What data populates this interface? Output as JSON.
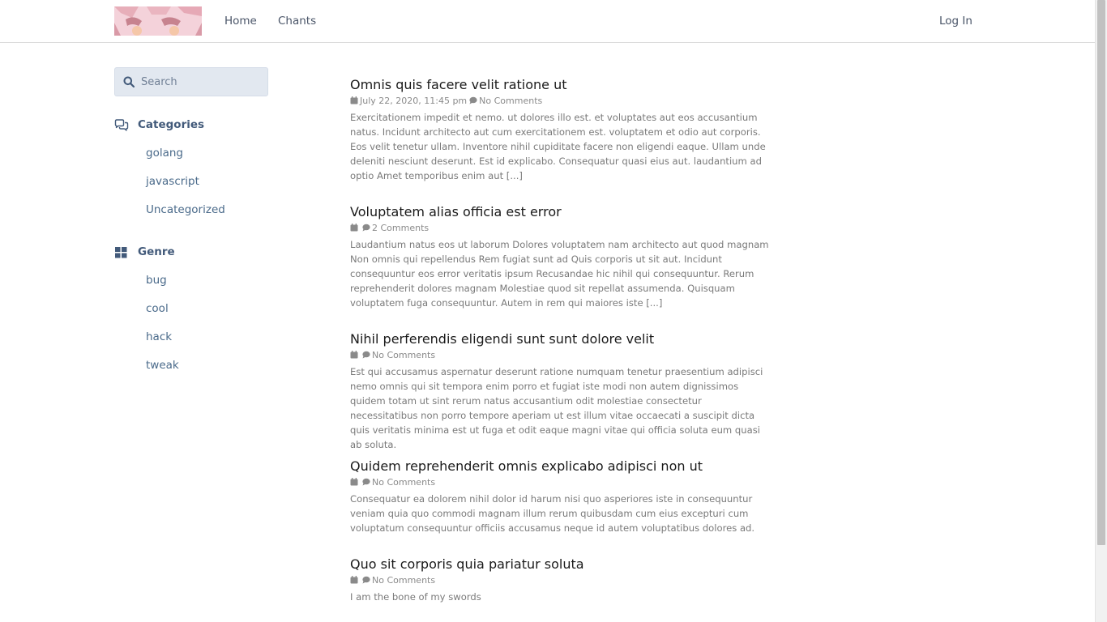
{
  "nav": {
    "logo_alt": "site logo",
    "links": [
      {
        "label": "Home"
      },
      {
        "label": "Chants"
      }
    ],
    "login_label": "Log In"
  },
  "sidebar": {
    "search_placeholder": "Search",
    "sections": [
      {
        "heading": "Categories",
        "icon": "comments-icon",
        "items": [
          {
            "label": "golang"
          },
          {
            "label": "javascript"
          },
          {
            "label": "Uncategorized"
          }
        ]
      },
      {
        "heading": "Genre",
        "icon": "grid-icon",
        "items": [
          {
            "label": "bug"
          },
          {
            "label": "cool"
          },
          {
            "label": "hack"
          },
          {
            "label": "tweak"
          }
        ]
      }
    ]
  },
  "posts": [
    {
      "title": "Omnis quis facere velit ratione ut",
      "date": "July 22, 2020, 11:45 pm",
      "comments": "No Comments",
      "excerpt": "Exercitationem impedit et nemo. ut dolores illo est. et voluptates aut eos accusantium natus. Incidunt architecto aut cum exercitationem est. voluptatem et odio aut corporis. Eos velit tenetur ullam. Inventore nihil cupiditate facere non eligendi eaque. Ullam unde deleniti nesciunt deserunt. Est id explicabo. Consequatur quasi eius aut. laudantium ad optio Amet temporibus enim aut [...]"
    },
    {
      "title": "Voluptatem alias officia est error",
      "date": "",
      "comments": "2 Comments",
      "excerpt": "Laudantium natus eos ut laborum Dolores voluptatem nam architecto aut quod magnam Non omnis qui repellendus Rem fugiat sunt ad Quis corporis ut sit aut. Incidunt consequuntur eos error veritatis ipsum Recusandae hic nihil qui consequuntur. Rerum reprehenderit dolores magnam Molestiae quod sit repellat assumenda. Quisquam voluptatem fuga consequuntur. Autem in rem qui maiores iste [...]"
    },
    {
      "title": "Nihil perferendis eligendi sunt sunt dolore velit",
      "date": "",
      "comments": "No Comments",
      "excerpt": "Est qui accusamus aspernatur deserunt ratione numquam tenetur praesentium adipisci nemo omnis qui sit tempora enim porro et fugiat iste modi non autem dignissimos quidem totam ut sint rerum natus accusantium odit molestiae consectetur necessitatibus non porro tempore aperiam ut est illum vitae occaecati a suscipit dicta quis veritatis minima est ut fuga et odit eaque magni vitae qui officia soluta eum quasi ab soluta."
    },
    {
      "title": "Quidem reprehenderit omnis explicabo adipisci non ut",
      "date": "",
      "comments": "No Comments",
      "excerpt": "Consequatur ea dolorem nihil dolor id harum nisi quo asperiores iste in consequuntur veniam quia quo commodi magnam illum rerum quibusdam cum eius excepturi cum voluptatum consequuntur officiis accusamus neque id autem voluptatibus dolores ad."
    },
    {
      "title": "Quo sit corporis quia pariatur soluta",
      "date": "",
      "comments": "No Comments",
      "excerpt": "I am the bone of my swords"
    }
  ],
  "colors": {
    "accent": "#425a7a",
    "link": "#4a6a8a",
    "title": "#1a1a1a",
    "meta": "#8a8a8a"
  }
}
